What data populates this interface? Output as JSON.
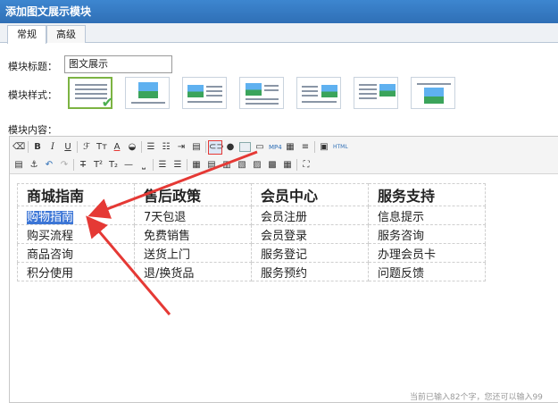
{
  "window": {
    "title": "添加图文展示模块"
  },
  "tabs": [
    {
      "label": "常规"
    },
    {
      "label": "高级"
    }
  ],
  "form": {
    "title_label": "模块标题：",
    "title_value": "图文展示",
    "style_label": "模块样式：",
    "content_label": "模块内容："
  },
  "editor": {
    "toolbar_row1": [
      "eraser-icon",
      "bold-icon",
      "italic-icon",
      "underline-icon",
      "format-painter-icon",
      "font-size-icon",
      "font-color-icon",
      "highlight-icon",
      "ordered-list-icon",
      "unordered-list-icon",
      "indent-icon",
      "justify-icon",
      "link-icon",
      "qq-icon",
      "image-icon",
      "screenshot-icon",
      "video-icon",
      "table-icon",
      "divider-icon",
      "source-icon",
      "html-icon"
    ],
    "toolbar_row2": [
      "paste-icon",
      "anchor-icon",
      "undo-icon",
      "redo-icon",
      "strikethrough-icon",
      "superscript-icon",
      "subscript-icon",
      "hr-icon",
      "underline-blank-icon",
      "align-left-icon",
      "align-center-icon",
      "table-insert-icon",
      "row-above-icon",
      "row-below-icon",
      "col-left-icon",
      "col-right-icon",
      "merge-icon",
      "split-icon",
      "fullscreen-icon"
    ],
    "table": {
      "headers": [
        "商城指南",
        "售后政策",
        "会员中心",
        "服务支持"
      ],
      "rows": [
        [
          "购物指南",
          "7天包退",
          "会员注册",
          "信息提示"
        ],
        [
          "购买流程",
          "免费销售",
          "会员登录",
          "服务咨询"
        ],
        [
          "商品咨询",
          "送货上门",
          "服务登记",
          "办理会员卡"
        ],
        [
          "积分使用",
          "退/换货品",
          "服务预约",
          "问题反馈"
        ]
      ]
    },
    "footer_note": "当前已输入82个字，您还可以输入99"
  },
  "colors": {
    "accent": "#2f6fb6",
    "arrow": "#e53935",
    "selection": "#3b75d6",
    "selected_style": "#7cb342"
  }
}
